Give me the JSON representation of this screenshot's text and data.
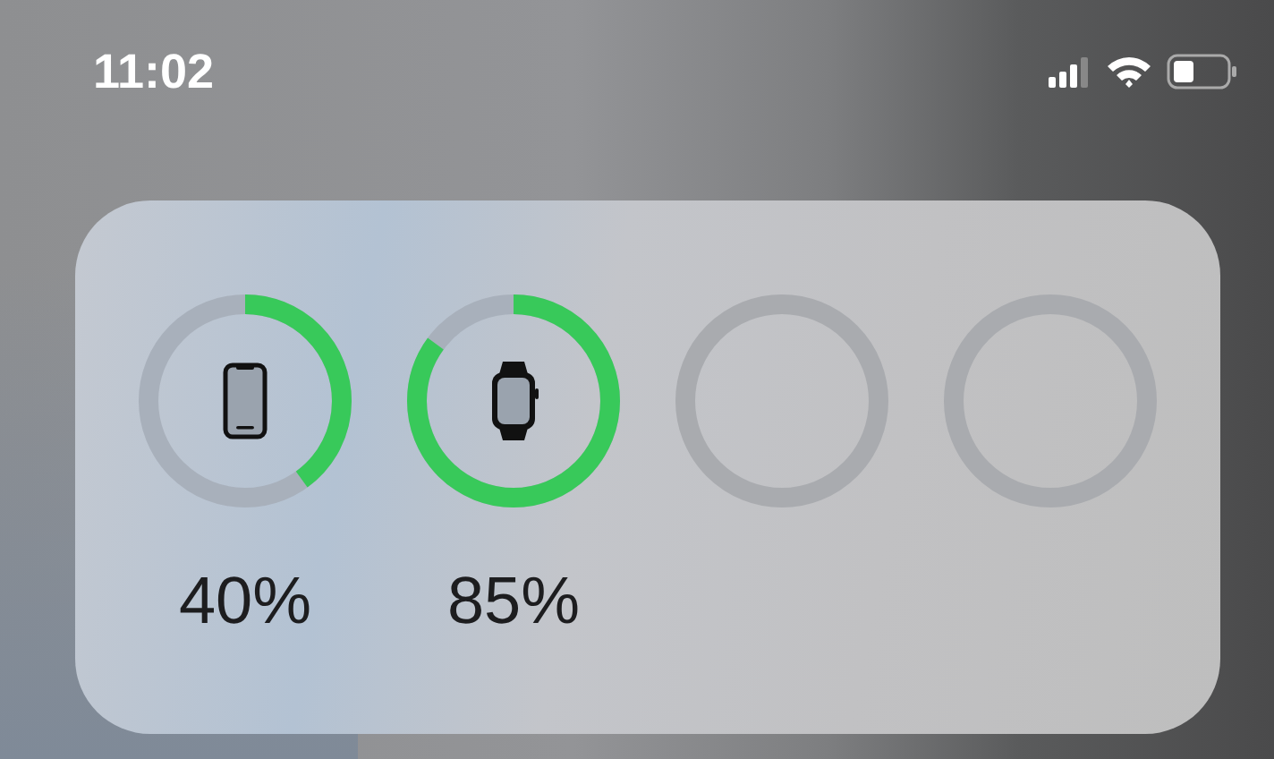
{
  "status_bar": {
    "time": "11:02"
  },
  "devices": [
    {
      "kind": "phone",
      "reading": "40%"
    },
    {
      "kind": "watch",
      "reading": "85%"
    },
    {
      "kind": "empty"
    },
    {
      "kind": "empty"
    }
  ]
}
